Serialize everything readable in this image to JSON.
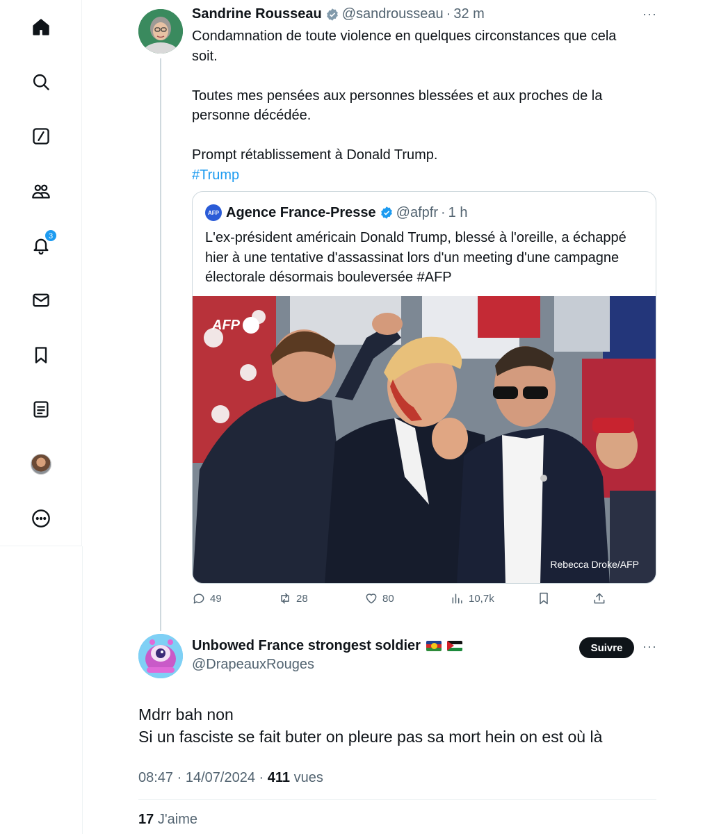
{
  "nav": {
    "notifications_count": "3"
  },
  "tweet": {
    "author_name": "Sandrine Rousseau",
    "handle": "@sandrousseau",
    "separator": "·",
    "time": "32 m",
    "more": "···",
    "lines": [
      "Condamnation de toute violence en quelques circonstances que cela soit.",
      "Toutes mes pensées aux personnes blessées et aux proches de la personne décédée.",
      "Prompt rétablissement à Donald Trump."
    ],
    "hashtag": "#Trump",
    "quote": {
      "logo_text": "AFP",
      "author_name": "Agence France-Presse",
      "handle": "@afpfr",
      "separator": "·",
      "time": "1 h",
      "text": "L'ex-président américain Donald Trump, blessé à l'oreille, a échappé hier à une tentative d'assassinat lors d'un meeting d'une campagne électorale désormais bouleversée #AFP",
      "photo_watermark": "AFP",
      "photo_credit": "Rebecca Droke/AFP"
    },
    "stats": {
      "replies": "49",
      "reposts": "28",
      "likes": "80",
      "views": "10,7k"
    }
  },
  "reply": {
    "author_name": "Unbowed France strongest soldier",
    "handle": "@DrapeauxRouges",
    "follow_label": "Suivre",
    "more": "···",
    "line1": "Mdrr bah non",
    "line2": "Si un fasciste se fait buter on pleure pas sa mort hein on est où là",
    "time": "08:47",
    "separator": "·",
    "date": "14/07/2024",
    "views_count": "411",
    "views_label": "vues",
    "likes_count": "17",
    "likes_label": "J'aime"
  },
  "colors": {
    "accent": "#1d9bf0",
    "text": "#0f1419",
    "muted": "#536471",
    "border": "#cfd9de"
  }
}
